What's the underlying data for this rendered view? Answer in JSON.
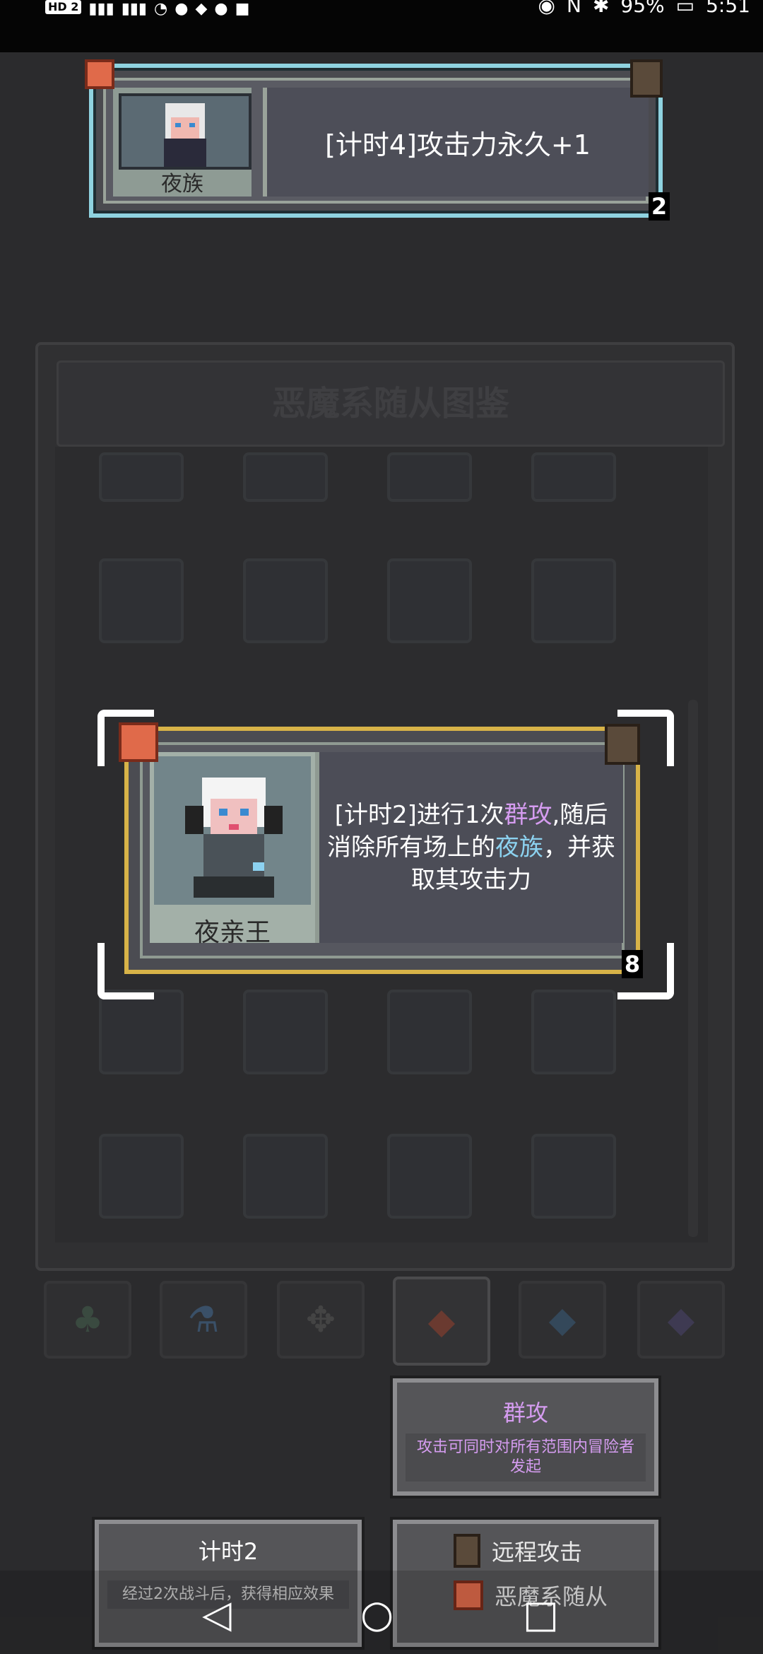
{
  "status_bar": {
    "hd_label": "HD 2",
    "battery": "95%",
    "time": "5:51"
  },
  "top_card": {
    "name": "夜族",
    "description": "[计时4]攻击力永久+1",
    "level": "2"
  },
  "panel": {
    "title": "恶魔系随从图鉴"
  },
  "main_card": {
    "name": "夜亲王",
    "description_parts": {
      "p1": "[计时2]进行1次",
      "p2": "群攻",
      "p3": ",随后消除所有场上的",
      "p4": "夜族",
      "p5": "，并获取其攻击力"
    },
    "level": "8",
    "highlight_colors": {
      "keyword": "#d59cf0",
      "tribe": "#8cd2f0"
    }
  },
  "tabs": [
    {
      "icon": "clover-icon"
    },
    {
      "icon": "flask-icon"
    },
    {
      "icon": "gear-icon"
    },
    {
      "icon": "demon-icon",
      "active": true
    },
    {
      "icon": "gem-icon"
    },
    {
      "icon": "diamond-icon"
    }
  ],
  "tooltips": {
    "group_attack": {
      "title": "群攻",
      "body": "攻击可同时对所有范围内冒险者发起"
    },
    "timer": {
      "title": "计时2",
      "body": "经过2次战斗后，获得相应效果"
    },
    "tags": {
      "ranged": "远程攻击",
      "demon": "恶魔系随从"
    }
  }
}
